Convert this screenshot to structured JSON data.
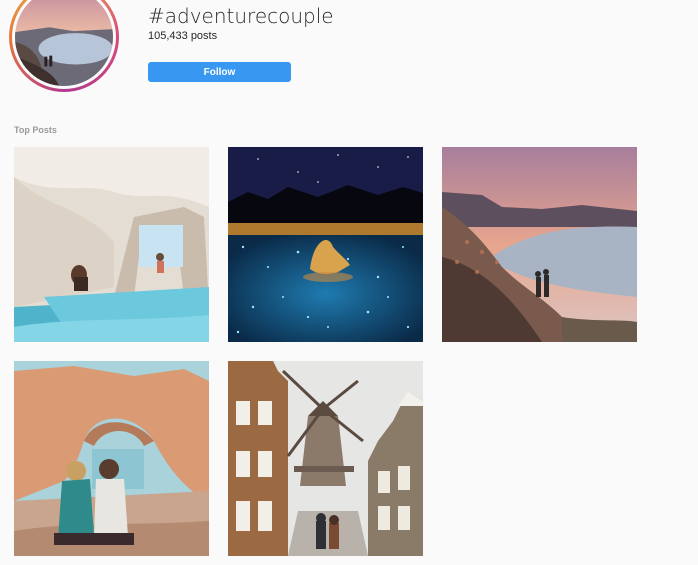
{
  "header": {
    "hashtag": "#adventurecouple",
    "posts_count": "105,433 posts",
    "follow_label": "Follow"
  },
  "sections": {
    "top_posts_label": "Top Posts"
  },
  "colors": {
    "follow_button": "#3897f0",
    "background": "#fafafa"
  }
}
